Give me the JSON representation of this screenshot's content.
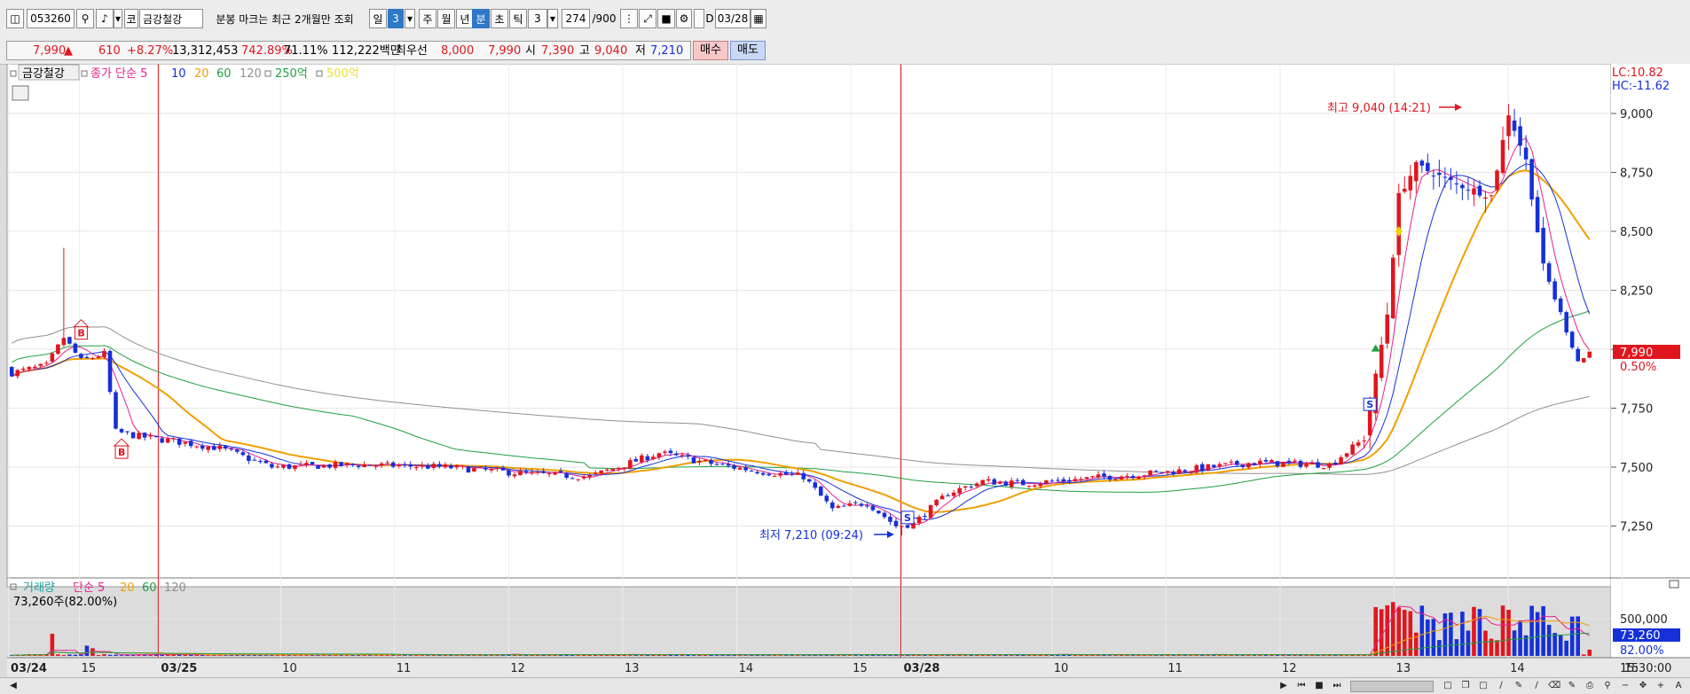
{
  "toolbar": {
    "code": "053260",
    "market": "코",
    "name": "금강철강",
    "notice": "분봉 마크는 최근 2개월만 조회",
    "periods": [
      "일",
      "3",
      "주",
      "월",
      "년",
      "분",
      "초",
      "틱"
    ],
    "interval": "3",
    "count": "274",
    "count_max": "/900",
    "d_label": "D",
    "date": "03/28"
  },
  "quote": {
    "price": "7,990",
    "arrow": "▲",
    "change": "610",
    "change_pct": "+8.27%",
    "volume": "13,312,453",
    "vol_ratio": "742.89%",
    "turnover": "71.11%",
    "amount": "112,222백만",
    "best_label": "최우선",
    "best_ask": "8,000",
    "best_bid": "7,990",
    "open_label": "시",
    "open": "7,390",
    "high_label": "고",
    "high": "9,040",
    "low_label": "저",
    "low": "7,210",
    "buy": "매수",
    "sell": "매도"
  },
  "colors": {
    "up": "#e0161e",
    "down": "#1530d8",
    "ma5": "#e8208c",
    "ma10": "#1530d8",
    "ma20": "#f0a000",
    "ma60": "#20a040",
    "ma120": "#909090"
  },
  "chart_data": {
    "type": "candlestick",
    "legend": {
      "name": "금강철강",
      "price_ma": "종가 단순 5",
      "ma_periods": [
        "10",
        "20",
        "60",
        "120"
      ],
      "extra1": "250억",
      "extra2": "500억"
    },
    "right_top": {
      "lc": "LC:10.82",
      "hc": "HC:-11.62"
    },
    "y_ticks": [
      "9,000",
      "8,750",
      "8,500",
      "8,250",
      "8,000",
      "7,750",
      "7,500",
      "7,250"
    ],
    "ylim": [
      7080,
      9120
    ],
    "current_price_label": "7,990",
    "current_pct_label": "0.50%",
    "x_labels": [
      "03/24",
      "15",
      "03/25",
      "10",
      "11",
      "12",
      "13",
      "14",
      "15",
      "03/28",
      "10",
      "11",
      "12",
      "13",
      "14",
      "15"
    ],
    "x_end_label": "15:30:00",
    "annotations": {
      "high": "최고 9,040 (14:21)",
      "low": "최저 7,210 (09:24)"
    },
    "signals": [
      {
        "type": "B",
        "side": "buy"
      },
      {
        "type": "B",
        "side": "buy"
      },
      {
        "type": "S",
        "side": "sell"
      },
      {
        "type": "S",
        "side": "sell"
      }
    ],
    "key_ohlc": [
      {
        "label": "03/24 open",
        "close": 7900
      },
      {
        "label": "03/24 spike",
        "high": 8430,
        "close": 8050
      },
      {
        "label": "03/25 open drop",
        "close": 7650
      },
      {
        "label": "low",
        "low": 7210
      },
      {
        "label": "high",
        "high": 9040
      },
      {
        "label": "last",
        "close": 7990
      }
    ],
    "volume": {
      "legend": {
        "name": "거래량",
        "ma_label": "단순 5",
        "ma_periods": [
          "20",
          "60",
          "120"
        ]
      },
      "last": "73,260주(82.00%)",
      "y_ticks": [
        "500,000"
      ],
      "current_label": "73,260",
      "current_pct": "82.00%"
    }
  }
}
